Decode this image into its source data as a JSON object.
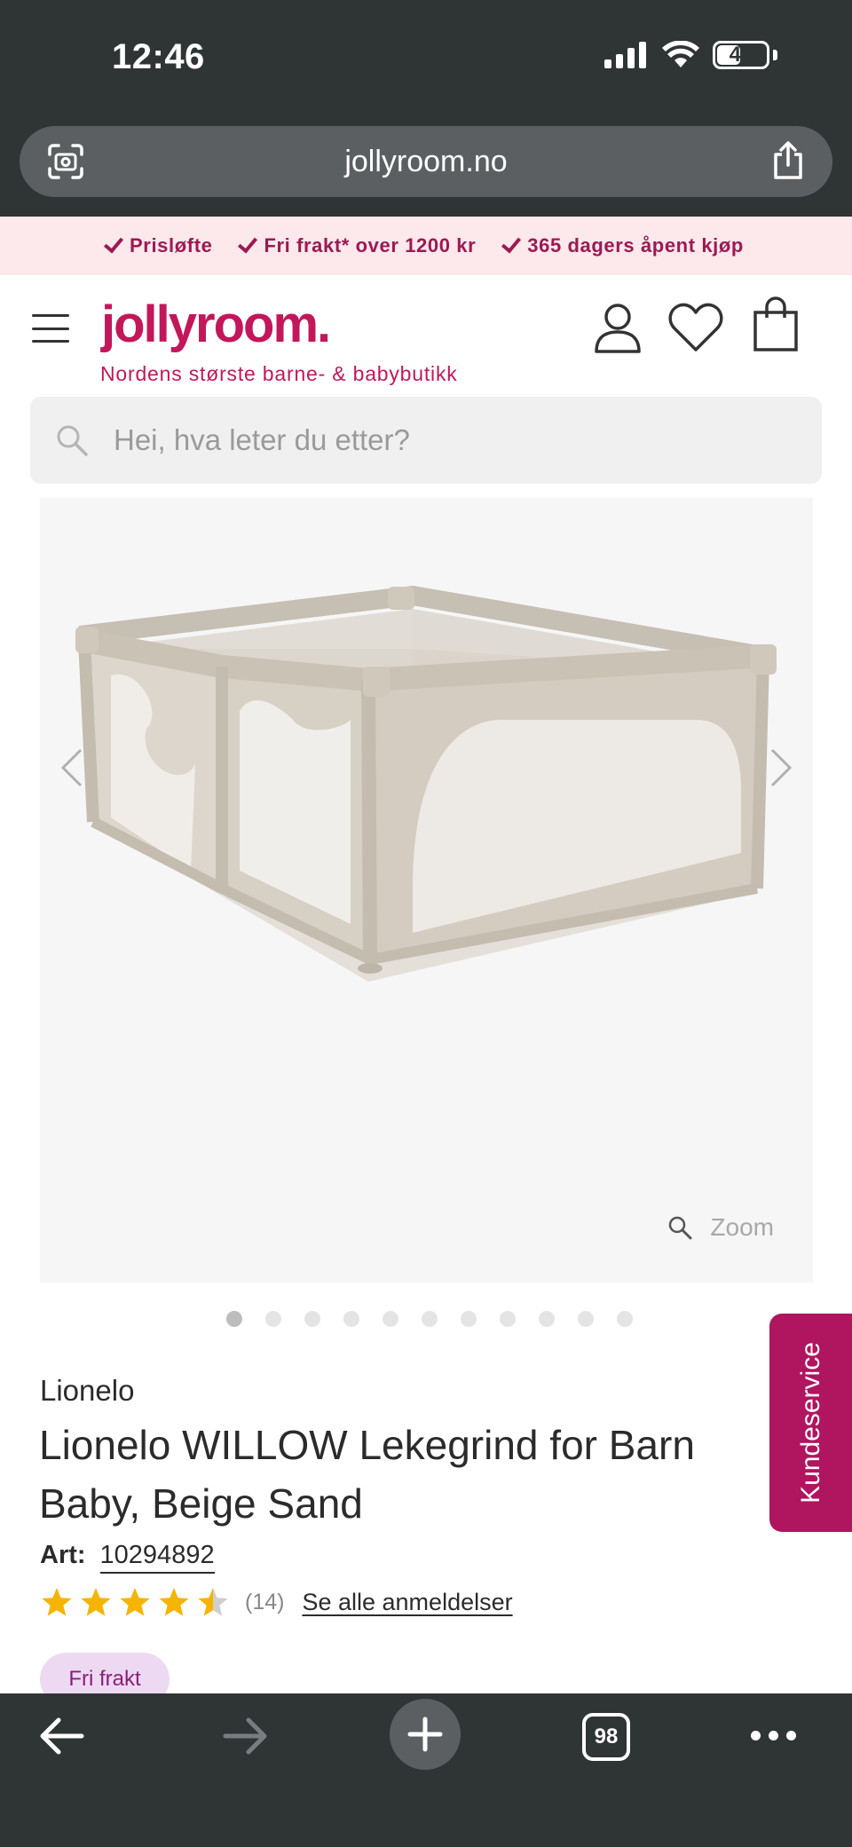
{
  "status_bar": {
    "time": "12:46",
    "battery": "40"
  },
  "browser": {
    "url": "jollyroom.no",
    "tab_count": "98"
  },
  "promo": {
    "items": [
      "Prisløfte",
      "Fri frakt* over 1200 kr",
      "365 dagers åpent kjøp"
    ]
  },
  "header": {
    "logo": "jollyroom.",
    "tagline": "Nordens største barne- & babybutikk"
  },
  "search": {
    "placeholder": "Hei, hva leter du etter?"
  },
  "gallery": {
    "zoom_label": "Zoom",
    "image_count": 11,
    "active_index": 0
  },
  "product": {
    "brand": "Lionelo",
    "title": "Lionelo WILLOW Lekegrind for Barn Baby, Beige Sand",
    "art_label": "Art:",
    "art_number": "10294892",
    "rating": 4.5,
    "review_count": "(14)",
    "reviews_link": "Se alle anmeldelser",
    "badge": "Fri frakt"
  },
  "customer_service": {
    "label": "Kundeservice"
  },
  "colors": {
    "brand": "#c2175b",
    "promo_bg": "#fde8ec",
    "chrome": "#2f3435",
    "star": "#f5b400"
  }
}
